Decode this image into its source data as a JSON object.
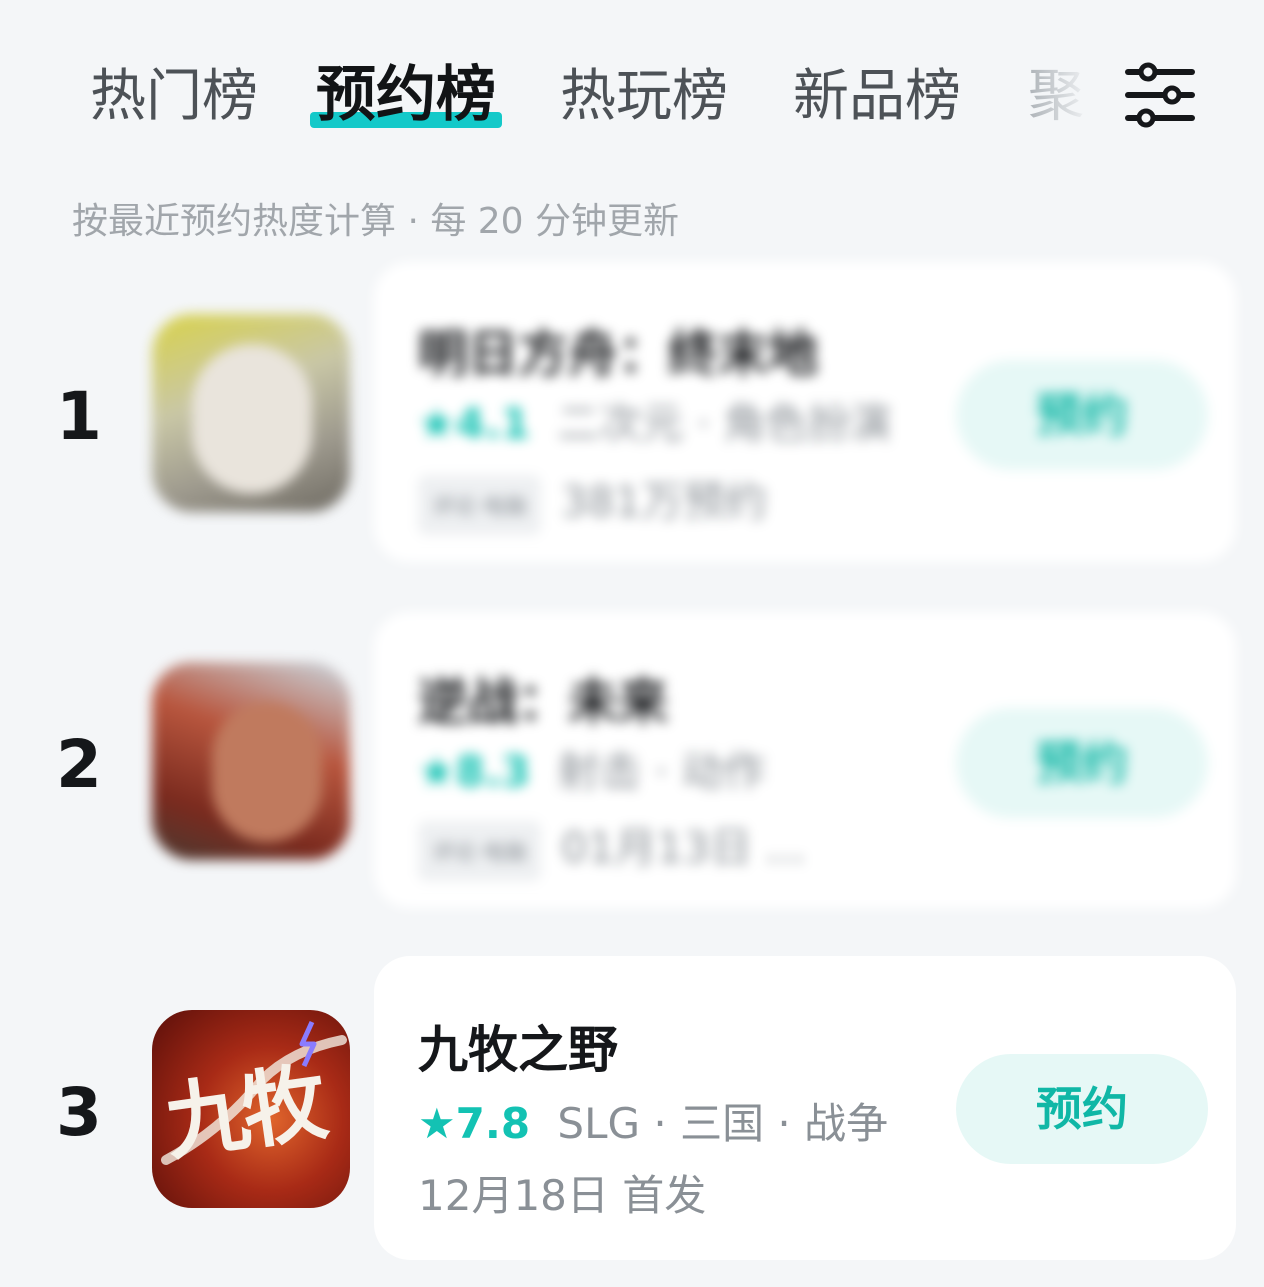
{
  "tabs": [
    {
      "label": "热门榜"
    },
    {
      "label": "预约榜"
    },
    {
      "label": "热玩榜"
    },
    {
      "label": "新品榜"
    },
    {
      "label": "聚"
    }
  ],
  "active_tab": "预约榜",
  "subtitle": "按最近预约热度计算 · 每 20 分钟更新",
  "items": [
    {
      "rank": "1",
      "title": "明日方舟：终末地",
      "score": "4.1",
      "genres": "二次元 · 角色扮演",
      "tag": "评论·电脑",
      "info": "381万预约",
      "button": "预约",
      "blurred": true
    },
    {
      "rank": "2",
      "title": "逆战：未来",
      "score": "8.3",
      "genres": "射击 · 动作",
      "tag": "评论·电脑",
      "info": "01月13日 ...",
      "button": "预约",
      "blurred": true
    },
    {
      "rank": "3",
      "title": "九牧之野",
      "score": "7.8",
      "genres": "SLG · 三国 · 战争",
      "info": "12月18日 首发",
      "button": "预约",
      "icon_text": "九牧",
      "blurred": false
    }
  ],
  "colors": {
    "accent": "#14c9c9",
    "button_bg": "#e6f8f6",
    "button_text": "#10b7a6",
    "background": "#f4f6f8"
  }
}
